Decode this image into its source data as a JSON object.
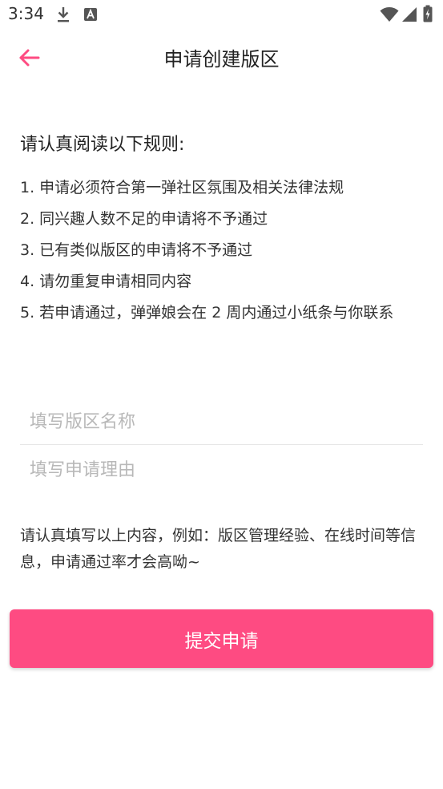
{
  "status_bar": {
    "time": "3:34",
    "icons": [
      "download-icon",
      "a-badge-icon",
      "wifi-icon",
      "cell-signal-icon",
      "battery-charging-icon"
    ]
  },
  "header": {
    "title": "申请创建版区",
    "back_icon": "arrow-left-icon",
    "accent_color": "#fe4b82"
  },
  "rules": {
    "heading": "请认真阅读以下规则:",
    "items": [
      "1. 申请必须符合第一弹社区氛围及相关法律法规",
      "2. 同兴趣人数不足的申请将不予通过",
      "3. 已有类似版区的申请将不予通过",
      "4. 请勿重复申请相同内容",
      "5. 若申请通过，弹弹娘会在 2 周内通过小纸条与你联系"
    ]
  },
  "form": {
    "name_placeholder": "填写版区名称",
    "reason_placeholder": "填写申请理由"
  },
  "hint": "请认真填写以上内容，例如：版区管理经验、在线时间等信息，申请通过率才会高呦~",
  "submit": {
    "label": "提交申请",
    "color": "#fe4b82"
  }
}
